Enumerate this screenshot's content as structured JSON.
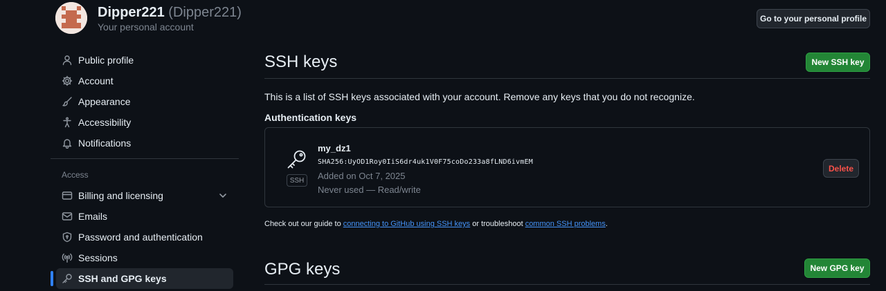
{
  "header": {
    "name": "Dipper221",
    "login": "(Dipper221)",
    "subtitle": "Your personal account",
    "profile_button": "Go to your personal profile"
  },
  "sidebar": {
    "items": [
      {
        "label": "Public profile",
        "icon": "person-icon"
      },
      {
        "label": "Account",
        "icon": "gear-icon"
      },
      {
        "label": "Appearance",
        "icon": "paintbrush-icon"
      },
      {
        "label": "Accessibility",
        "icon": "accessibility-icon"
      },
      {
        "label": "Notifications",
        "icon": "bell-icon"
      }
    ],
    "section_access": "Access",
    "access_items": [
      {
        "label": "Billing and licensing",
        "icon": "credit-card-icon"
      },
      {
        "label": "Emails",
        "icon": "mail-icon"
      },
      {
        "label": "Password and authentication",
        "icon": "shield-lock-icon"
      },
      {
        "label": "Sessions",
        "icon": "broadcast-icon"
      },
      {
        "label": "SSH and GPG keys",
        "icon": "key-icon",
        "active": true
      }
    ]
  },
  "ssh": {
    "title": "SSH keys",
    "new_button": "New SSH key",
    "description": "This is a list of SSH keys associated with your account. Remove any keys that you do not recognize.",
    "auth_heading": "Authentication keys",
    "keys": [
      {
        "title": "my_dz1",
        "fingerprint": "SHA256:UyOD1Roy0IiS6dr4uk1V0F75coDo233a8fLND6ivmEM",
        "added": "Added on Oct 7, 2025",
        "usage": "Never used — Read/write",
        "type_label": "SSH",
        "delete_label": "Delete"
      }
    ],
    "guide": {
      "prefix": "Check out our guide to ",
      "link1": "connecting to GitHub using SSH keys",
      "middle": " or troubleshoot ",
      "link2": "common SSH problems",
      "suffix": "."
    }
  },
  "gpg": {
    "title": "GPG keys",
    "new_button": "New GPG key"
  },
  "colors": {
    "background": "#0d1117",
    "primary_button": "#238636",
    "link": "#4493f8",
    "danger": "#f85149",
    "active_indicator": "#2f81f7"
  }
}
